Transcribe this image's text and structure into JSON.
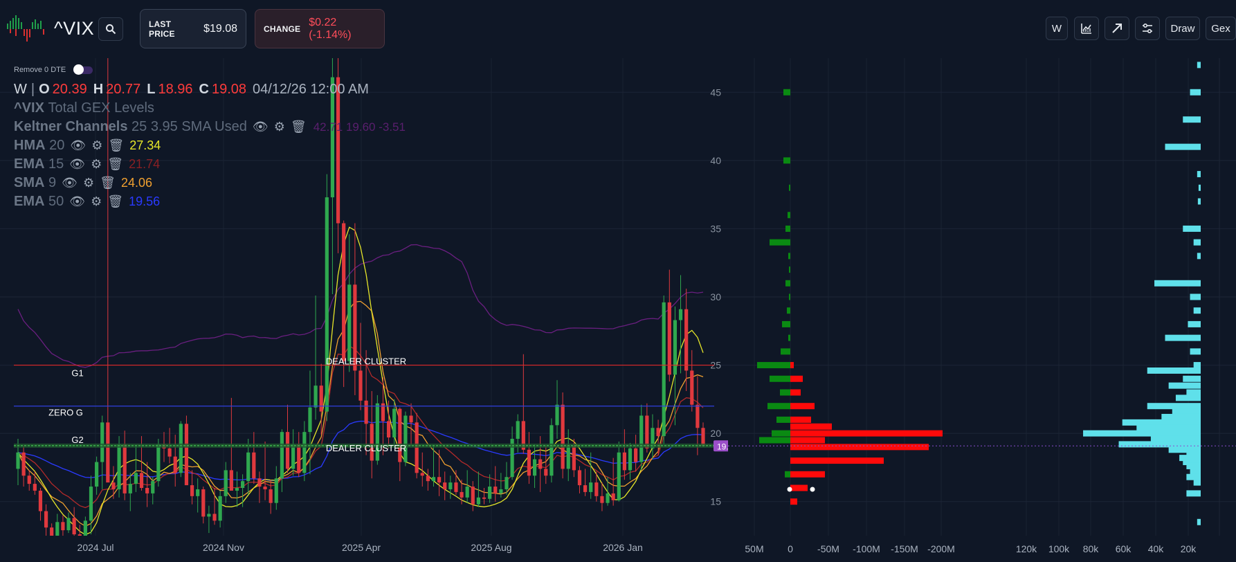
{
  "header": {
    "ticker": "^VIX",
    "last_price_label": "LAST PRICE",
    "last_price": "$19.08",
    "change_label": "CHANGE",
    "change_value": "$0.22 (-1.14%)",
    "toolbar": {
      "w_label": "W",
      "draw_label": "Draw",
      "gex_label": "Gex"
    },
    "icons": [
      "search-icon",
      "chart-line-icon",
      "arrow-up-right-icon",
      "sliders-icon"
    ]
  },
  "toggle": {
    "label": "Remove 0 DTE",
    "on": true
  },
  "ohlc": {
    "interval": "W",
    "o": "20.39",
    "h": "20.77",
    "l": "18.96",
    "c": "19.08",
    "datetime": "04/12/26 12:00 AM"
  },
  "indicators": [
    {
      "name": "^VIX",
      "desc": "Total GEX Levels",
      "params": "",
      "value": ""
    },
    {
      "name": "Keltner Channels",
      "desc": "",
      "params": "25 3.95 SMA Used",
      "value": "42.71 19.60 -3.51",
      "color": "#7a1f8f"
    },
    {
      "name": "HMA",
      "desc": "",
      "params": "20",
      "value": "27.34",
      "color": "#e6e629"
    },
    {
      "name": "EMA",
      "desc": "",
      "params": "15",
      "value": "21.74",
      "color": "#b22a2a"
    },
    {
      "name": "SMA",
      "desc": "",
      "params": "9",
      "value": "24.06",
      "color": "#f0a030"
    },
    {
      "name": "EMA",
      "desc": "",
      "params": "50",
      "value": "19.56",
      "color": "#2a3aff"
    }
  ],
  "levels": {
    "g1_label": "G1",
    "zerog_label": "ZERO G",
    "g2_label": "G2",
    "dealer_label": "DEALER CLUSTER",
    "g1_value": 25.0,
    "zerog_value": 22.0,
    "g2_value": 19.1,
    "current_price_tag": "19.08"
  },
  "chart_data": {
    "type": "candlestick",
    "x_ticks": [
      "2024 Jul",
      "2024 Nov",
      "2025 Apr",
      "2025 Aug",
      "2026 Jan"
    ],
    "y_ticks": [
      "15",
      "20",
      "25",
      "30",
      "35",
      "40",
      "45"
    ],
    "ylim": [
      12.5,
      47.5
    ],
    "colors": {
      "up": "#2fa84f",
      "down": "#e0393e",
      "background": "#0f1726"
    },
    "candles": [
      [
        17.4,
        19.6,
        16.2,
        18.6
      ],
      [
        18.6,
        19.1,
        16.1,
        16.9
      ],
      [
        16.9,
        17.3,
        15.8,
        16.3
      ],
      [
        16.3,
        17.2,
        15.5,
        15.8
      ],
      [
        15.8,
        16.0,
        13.6,
        14.3
      ],
      [
        14.3,
        14.8,
        12.4,
        13.1
      ],
      [
        13.1,
        13.4,
        12.1,
        12.5
      ],
      [
        12.5,
        14.1,
        12.2,
        13.5
      ],
      [
        13.5,
        14.0,
        12.3,
        12.9
      ],
      [
        12.9,
        14.2,
        12.7,
        13.8
      ],
      [
        13.8,
        14.6,
        12.2,
        12.6
      ],
      [
        12.6,
        13.3,
        11.9,
        12.5
      ],
      [
        12.5,
        13.9,
        12.4,
        13.6
      ],
      [
        13.6,
        16.9,
        12.6,
        16.1
      ],
      [
        16.1,
        18.3,
        15.5,
        17.9
      ],
      [
        17.9,
        21.3,
        15.9,
        20.8
      ],
      [
        20.8,
        65.7,
        19.2,
        16.4
      ],
      [
        16.4,
        17.6,
        15.2,
        15.9
      ],
      [
        15.9,
        19.8,
        15.3,
        19.2
      ],
      [
        19.2,
        20.2,
        15.1,
        15.6
      ],
      [
        15.6,
        17.1,
        14.3,
        16.3
      ],
      [
        16.3,
        19.1,
        15.7,
        17.1
      ],
      [
        17.1,
        19.8,
        15.8,
        16.0
      ],
      [
        16.0,
        17.9,
        14.6,
        15.6
      ],
      [
        15.6,
        16.8,
        14.8,
        16.5
      ],
      [
        16.5,
        19.6,
        16.1,
        19.2
      ],
      [
        19.2,
        20.1,
        17.9,
        18.9
      ],
      [
        18.9,
        20.4,
        17.8,
        18.3
      ],
      [
        18.3,
        19.9,
        16.1,
        17.1
      ],
      [
        17.1,
        20.9,
        16.8,
        20.7
      ],
      [
        20.7,
        21.3,
        16.4,
        16.2
      ],
      [
        16.2,
        17.3,
        14.8,
        15.4
      ],
      [
        15.4,
        16.7,
        14.2,
        15.9
      ],
      [
        15.9,
        16.1,
        13.4,
        13.9
      ],
      [
        13.9,
        14.7,
        12.7,
        14.1
      ],
      [
        14.1,
        16.0,
        13.3,
        13.6
      ],
      [
        13.6,
        15.8,
        13.1,
        15.4
      ],
      [
        15.4,
        17.9,
        14.9,
        17.3
      ],
      [
        17.3,
        22.6,
        16.9,
        15.8
      ],
      [
        15.8,
        17.2,
        14.6,
        16.0
      ],
      [
        16.0,
        17.0,
        14.6,
        16.5
      ],
      [
        16.5,
        19.6,
        15.5,
        18.6
      ],
      [
        18.6,
        20.1,
        16.3,
        16.7
      ],
      [
        16.7,
        17.2,
        14.9,
        16.1
      ],
      [
        16.1,
        19.4,
        15.1,
        15.9
      ],
      [
        15.9,
        16.6,
        14.1,
        14.9
      ],
      [
        14.9,
        17.6,
        14.4,
        16.7
      ],
      [
        16.7,
        20.3,
        15.7,
        20.1
      ],
      [
        20.1,
        22.1,
        17.1,
        17.4
      ],
      [
        17.4,
        20.3,
        16.9,
        19.2
      ],
      [
        19.2,
        20.1,
        16.8,
        17.1
      ],
      [
        17.1,
        20.9,
        16.5,
        20.1
      ],
      [
        20.1,
        24.6,
        17.0,
        21.9
      ],
      [
        21.9,
        30.1,
        21.0,
        23.5
      ],
      [
        23.5,
        25.1,
        19.9,
        21.6
      ],
      [
        21.6,
        39.0,
        20.9,
        37.3
      ],
      [
        37.3,
        65.0,
        30.2,
        46.1
      ],
      [
        46.1,
        53.0,
        33.2,
        35.4
      ],
      [
        35.4,
        35.6,
        23.4,
        25.3
      ],
      [
        25.3,
        34.6,
        24.5,
        30.9
      ],
      [
        30.9,
        35.4,
        22.8,
        24.6
      ],
      [
        24.6,
        28.1,
        21.7,
        22.4
      ],
      [
        22.4,
        26.1,
        18.4,
        20.7
      ],
      [
        20.7,
        23.1,
        16.7,
        18.0
      ],
      [
        18.0,
        22.8,
        17.7,
        22.2
      ],
      [
        22.2,
        24.1,
        18.4,
        20.9
      ],
      [
        20.9,
        22.4,
        18.9,
        19.7
      ],
      [
        19.7,
        22.5,
        19.1,
        21.8
      ],
      [
        21.8,
        21.9,
        16.5,
        17.9
      ],
      [
        17.9,
        21.6,
        17.6,
        21.3
      ],
      [
        21.3,
        22.2,
        19.1,
        20.8
      ],
      [
        20.8,
        21.5,
        16.7,
        17.1
      ],
      [
        17.1,
        18.6,
        16.1,
        16.9
      ],
      [
        16.9,
        17.4,
        15.8,
        16.5
      ],
      [
        16.5,
        19.1,
        16.1,
        16.8
      ],
      [
        16.8,
        18.8,
        15.4,
        16.4
      ],
      [
        16.4,
        17.2,
        15.1,
        15.9
      ],
      [
        15.9,
        16.9,
        15.2,
        16.4
      ],
      [
        16.4,
        17.3,
        15.5,
        15.7
      ],
      [
        15.7,
        16.6,
        14.8,
        15.3
      ],
      [
        15.3,
        17.3,
        14.9,
        16.1
      ],
      [
        16.1,
        16.5,
        14.3,
        14.8
      ],
      [
        14.8,
        17.2,
        14.6,
        15.3
      ],
      [
        15.3,
        16.0,
        14.8,
        15.2
      ],
      [
        15.2,
        17.0,
        14.9,
        16.1
      ],
      [
        16.1,
        17.6,
        15.0,
        15.6
      ],
      [
        15.6,
        17.1,
        15.3,
        15.9
      ],
      [
        15.9,
        17.9,
        15.5,
        16.8
      ],
      [
        16.8,
        20.5,
        16.6,
        19.6
      ],
      [
        19.6,
        21.4,
        18.6,
        20.9
      ],
      [
        20.9,
        25.8,
        18.5,
        18.8
      ],
      [
        18.8,
        20.1,
        16.3,
        16.9
      ],
      [
        16.9,
        19.2,
        16.0,
        18.1
      ],
      [
        18.1,
        19.8,
        15.7,
        17.4
      ],
      [
        17.4,
        19.1,
        16.3,
        16.9
      ],
      [
        16.9,
        21.1,
        16.4,
        20.6
      ],
      [
        20.6,
        23.9,
        19.6,
        22.1
      ],
      [
        22.1,
        23.0,
        16.7,
        17.4
      ],
      [
        17.4,
        20.3,
        16.5,
        19.1
      ],
      [
        19.1,
        19.6,
        16.8,
        17.3
      ],
      [
        17.3,
        17.6,
        15.6,
        16.2
      ],
      [
        16.2,
        17.4,
        15.4,
        15.7
      ],
      [
        15.7,
        18.6,
        15.2,
        16.4
      ],
      [
        16.4,
        17.2,
        15.0,
        15.4
      ],
      [
        15.4,
        16.4,
        14.3,
        14.9
      ],
      [
        14.9,
        16.8,
        14.7,
        15.6
      ],
      [
        15.6,
        18.2,
        14.7,
        15.1
      ],
      [
        15.1,
        19.4,
        15.0,
        18.6
      ],
      [
        18.6,
        20.3,
        16.6,
        17.3
      ],
      [
        17.3,
        19.3,
        16.6,
        18.9
      ],
      [
        18.9,
        19.9,
        17.2,
        17.9
      ],
      [
        17.9,
        22.1,
        17.3,
        21.3
      ],
      [
        21.3,
        22.2,
        18.6,
        18.9
      ],
      [
        18.9,
        21.4,
        18.1,
        20.4
      ],
      [
        20.4,
        21.0,
        18.4,
        19.8
      ],
      [
        19.8,
        30.1,
        19.2,
        29.6
      ],
      [
        29.6,
        32.0,
        23.8,
        24.3
      ],
      [
        24.3,
        29.3,
        20.6,
        28.3
      ],
      [
        28.3,
        31.6,
        24.4,
        29.1
      ],
      [
        29.1,
        30.6,
        23.1,
        24.6
      ],
      [
        24.6,
        26.1,
        21.6,
        22.1
      ],
      [
        22.1,
        24.2,
        18.4,
        20.4
      ],
      [
        20.4,
        20.8,
        19.0,
        19.1
      ]
    ]
  },
  "gex_panel": {
    "x_ticks": [
      "50M",
      "0",
      "-50M",
      "-100M",
      "-150M",
      "-200M"
    ],
    "bars_pos": [
      [
        45,
        -10
      ],
      [
        40,
        -10
      ],
      [
        38,
        -2
      ],
      [
        36,
        -4
      ],
      [
        35,
        -7
      ],
      [
        34,
        -30
      ],
      [
        33,
        -3
      ],
      [
        32,
        -2
      ],
      [
        31,
        -7
      ],
      [
        30,
        -2
      ],
      [
        29,
        -5
      ],
      [
        28,
        -12
      ],
      [
        27,
        -3
      ],
      [
        26,
        -14
      ],
      [
        25,
        -48
      ],
      [
        24,
        -30
      ],
      [
        23,
        -15
      ],
      [
        22,
        -33
      ],
      [
        21,
        -20
      ],
      [
        20,
        -27
      ],
      [
        19.5,
        -45
      ],
      [
        17,
        -8
      ]
    ],
    "bars_neg": [
      [
        25,
        5
      ],
      [
        24,
        18
      ],
      [
        23,
        15
      ],
      [
        22,
        35
      ],
      [
        21,
        30
      ],
      [
        20.5,
        60
      ],
      [
        20,
        220
      ],
      [
        19.5,
        50
      ],
      [
        19,
        200
      ],
      [
        18,
        135
      ],
      [
        17,
        50
      ],
      [
        16,
        25
      ],
      [
        15,
        10
      ]
    ]
  },
  "volume_panel": {
    "x_ticks": [
      "120k",
      "100k",
      "80k",
      "60k",
      "40k",
      "20k"
    ],
    "bars": [
      [
        47,
        5
      ],
      [
        45,
        15
      ],
      [
        43,
        25
      ],
      [
        41,
        50
      ],
      [
        39,
        5
      ],
      [
        38,
        3
      ],
      [
        37,
        4
      ],
      [
        35,
        25
      ],
      [
        34,
        10
      ],
      [
        33,
        5
      ],
      [
        31,
        65
      ],
      [
        30,
        15
      ],
      [
        29,
        10
      ],
      [
        28,
        18
      ],
      [
        27,
        50
      ],
      [
        26,
        15
      ],
      [
        25,
        10
      ],
      [
        24.6,
        75
      ],
      [
        24,
        25
      ],
      [
        23.5,
        45
      ],
      [
        23,
        20
      ],
      [
        22.6,
        35
      ],
      [
        22,
        75
      ],
      [
        21.6,
        40
      ],
      [
        21.2,
        55
      ],
      [
        20.8,
        110
      ],
      [
        20.4,
        90
      ],
      [
        20,
        165
      ],
      [
        19.6,
        70
      ],
      [
        19.2,
        115
      ],
      [
        18.8,
        45
      ],
      [
        18.5,
        20
      ],
      [
        18.2,
        30
      ],
      [
        17.9,
        25
      ],
      [
        17.6,
        20
      ],
      [
        17.2,
        15
      ],
      [
        16.8,
        20
      ],
      [
        16.4,
        10
      ],
      [
        15.6,
        20
      ],
      [
        13.5,
        5
      ]
    ]
  }
}
